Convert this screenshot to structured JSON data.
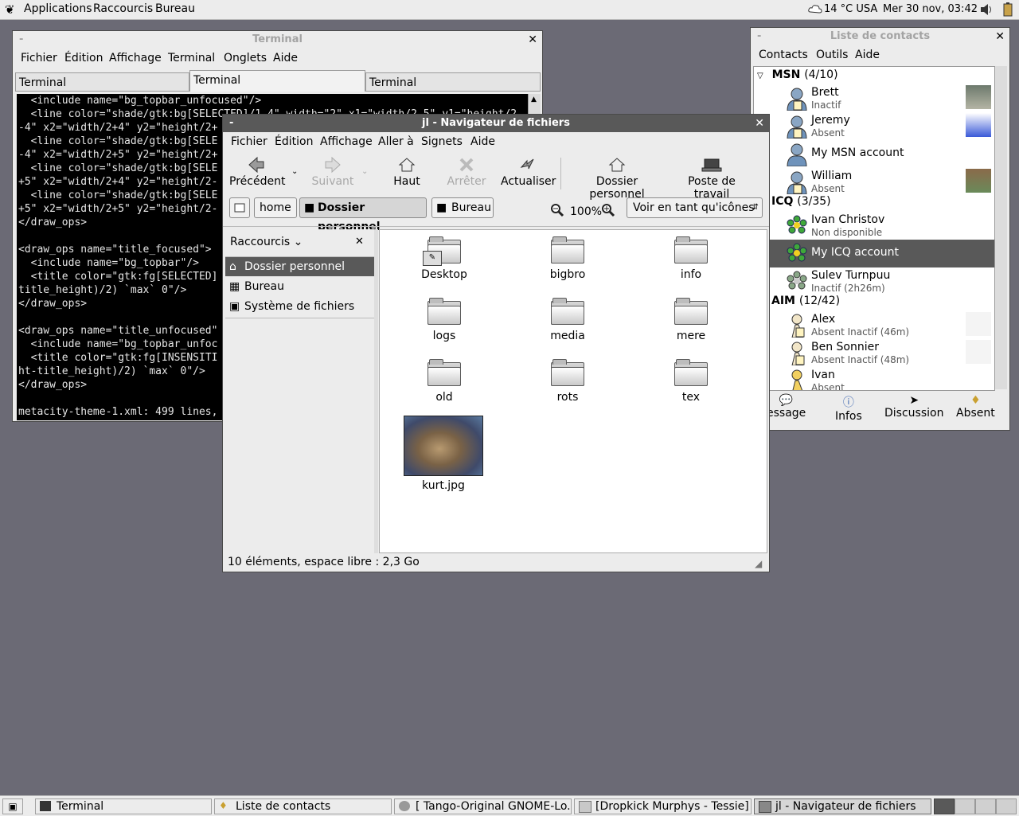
{
  "top_panel": {
    "menus": [
      "Applications",
      "Raccourcis",
      "Bureau"
    ],
    "weather": "14 °C USA",
    "clock": "Mer 30 nov, 03:42"
  },
  "terminal": {
    "title": "Terminal",
    "menus": [
      "Fichier",
      "Édition",
      "Affichage",
      "Terminal",
      "Onglets",
      "Aide"
    ],
    "tabs": [
      "Terminal",
      "Terminal",
      "Terminal"
    ],
    "lines": [
      "  <include name=\"bg_topbar_unfocused\"/>",
      "  <line color=\"shade/gtk:bg[SELECTED]/1.4\" width=\"2\" x1=\"width/2.5\" y1=\"height/2",
      "-4\" x2=\"width/2+4\" y2=\"height/2+",
      "  <line color=\"shade/gtk:bg[SELE",
      "-4\" x2=\"width/2+5\" y2=\"height/2+",
      "  <line color=\"shade/gtk:bg[SELE",
      "+5\" x2=\"width/2+4\" y2=\"height/2-",
      "  <line color=\"shade/gtk:bg[SELE",
      "+5\" x2=\"width/2+5\" y2=\"height/2-",
      "</draw_ops>",
      "",
      "<draw_ops name=\"title_focused\">",
      "  <include name=\"bg_topbar\"/>",
      "  <title color=\"gtk:fg[SELECTED]",
      "title_height)/2) `max` 0\"/>",
      "</draw_ops>",
      "",
      "<draw_ops name=\"title_unfocused\"",
      "  <include name=\"bg_topbar_unfoc",
      "  <title color=\"gtk:fg[INSENSITI",
      "ht-title_height)/2) `max` 0\"/>",
      "</draw_ops>",
      "",
      "metacity-theme-1.xml: 499 lines,"
    ]
  },
  "contacts": {
    "title": "Liste de contacts",
    "menus": [
      "Contacts",
      "Outils",
      "Aide"
    ],
    "groups": [
      {
        "name": "MSN",
        "count": "(4/10)"
      },
      {
        "name": "ICQ",
        "count": "(3/35)"
      },
      {
        "name": "AIM",
        "count": "(12/42)"
      }
    ],
    "items": [
      {
        "name": "Brett",
        "status": "Inactif"
      },
      {
        "name": "Jeremy",
        "status": "Absent"
      },
      {
        "name": "My MSN account",
        "status": ""
      },
      {
        "name": "William",
        "status": "Absent"
      },
      {
        "name": "Ivan Christov",
        "status": "Non disponible"
      },
      {
        "name": "My ICQ account",
        "status": ""
      },
      {
        "name": "Sulev Turnpuu",
        "status": "Inactif (2h26m)"
      },
      {
        "name": "Alex",
        "status": "Absent Inactif (46m)"
      },
      {
        "name": "Ben Sonnier",
        "status": "Absent Inactif (48m)"
      },
      {
        "name": "Ivan",
        "status": "Absent"
      }
    ],
    "actions": [
      "essage",
      "Infos",
      "Discussion",
      "Absent"
    ]
  },
  "filebrowser": {
    "title": "jl - Navigateur de fichiers",
    "menus": [
      "Fichier",
      "Édition",
      "Affichage",
      "Aller à",
      "Signets",
      "Aide"
    ],
    "toolbar": {
      "back": "Précédent",
      "forward": "Suivant",
      "up": "Haut",
      "stop": "Arrêter",
      "reload": "Actualiser",
      "home": "Dossier personnel",
      "computer": "Poste de travail"
    },
    "path": [
      "home",
      "Dossier personnel",
      "Bureau"
    ],
    "zoom": "100%",
    "view_mode": "Voir en tant qu'icônes",
    "sidebar_title": "Raccourcis",
    "places": [
      "Dossier personnel",
      "Bureau",
      "Système de fichiers"
    ],
    "files": [
      "Desktop",
      "bigbro",
      "info",
      "logs",
      "media",
      "mere",
      "old",
      "rots",
      "tex",
      "kurt.jpg"
    ],
    "statusbar": "10 éléments, espace libre : 2,3 Go"
  },
  "taskbar": {
    "tasks": [
      "Terminal",
      "Liste de contacts",
      "[ Tango-Original GNOME-Lo...",
      "[Dropkick Murphys - Tessie]",
      "jl - Navigateur de fichiers"
    ]
  }
}
